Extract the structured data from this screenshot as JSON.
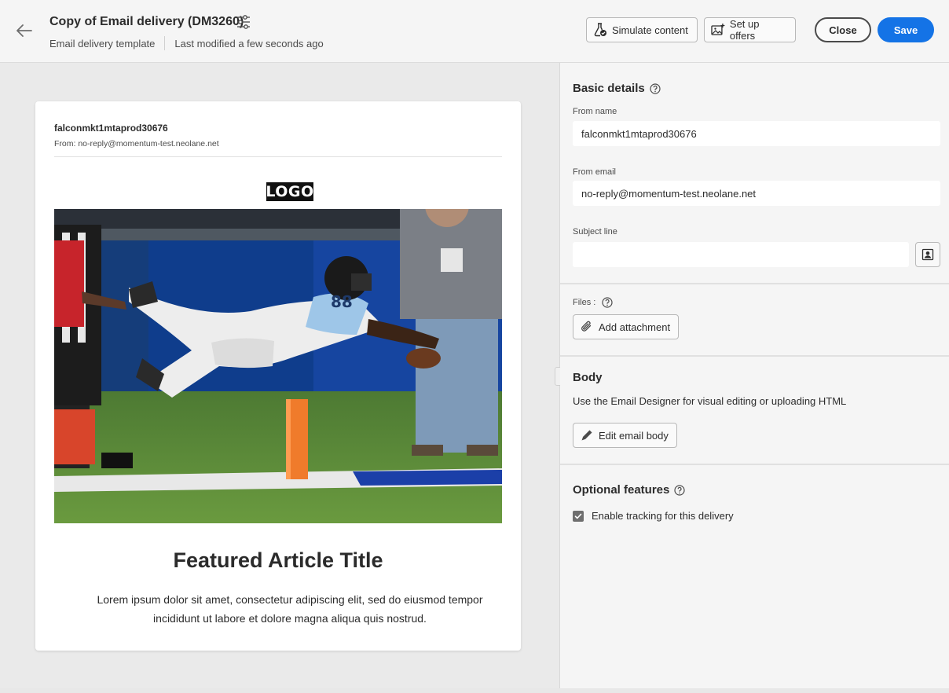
{
  "header": {
    "title": "Copy of Email delivery (DM3260)",
    "template_label": "Email delivery template",
    "last_modified": "Last modified a few seconds ago",
    "simulate_label": "Simulate content",
    "offers_label": "Set up offers",
    "close_label": "Close",
    "save_label": "Save"
  },
  "preview": {
    "sender_name": "falconmkt1mtaprod30676",
    "from_line": "From: no-reply@momentum-test.neolane.net",
    "logo_text": "LOGO",
    "article_title": "Featured Article Title",
    "article_body": "Lorem ipsum dolor sit amet, consectetur adipiscing elit, sed do eiusmod tempor incididunt ut labore et dolore magna aliqua quis nostrud.",
    "hero_jersey_number": "88"
  },
  "basic_details": {
    "title": "Basic details",
    "from_name_label": "From name",
    "from_name_value": "falconmkt1mtaprod30676",
    "from_email_label": "From email",
    "from_email_value": "no-reply@momentum-test.neolane.net",
    "subject_label": "Subject line",
    "subject_value": ""
  },
  "files": {
    "label": "Files :",
    "add_attachment_label": "Add attachment"
  },
  "body_section": {
    "title": "Body",
    "description": "Use the Email Designer for visual editing or uploading HTML",
    "edit_label": "Edit email body"
  },
  "optional": {
    "title": "Optional features",
    "tracking_label": "Enable tracking for this delivery",
    "tracking_checked": true
  },
  "colors": {
    "accent": "#1473e6",
    "panel_bg": "#f5f5f5",
    "preview_bg": "#eaeaea"
  },
  "icons": [
    "back-arrow-icon",
    "settings-sliders-icon",
    "flask-icon",
    "image-add-icon",
    "help-icon",
    "personalization-icon",
    "paperclip-icon",
    "pencil-icon",
    "checkmark-icon"
  ]
}
